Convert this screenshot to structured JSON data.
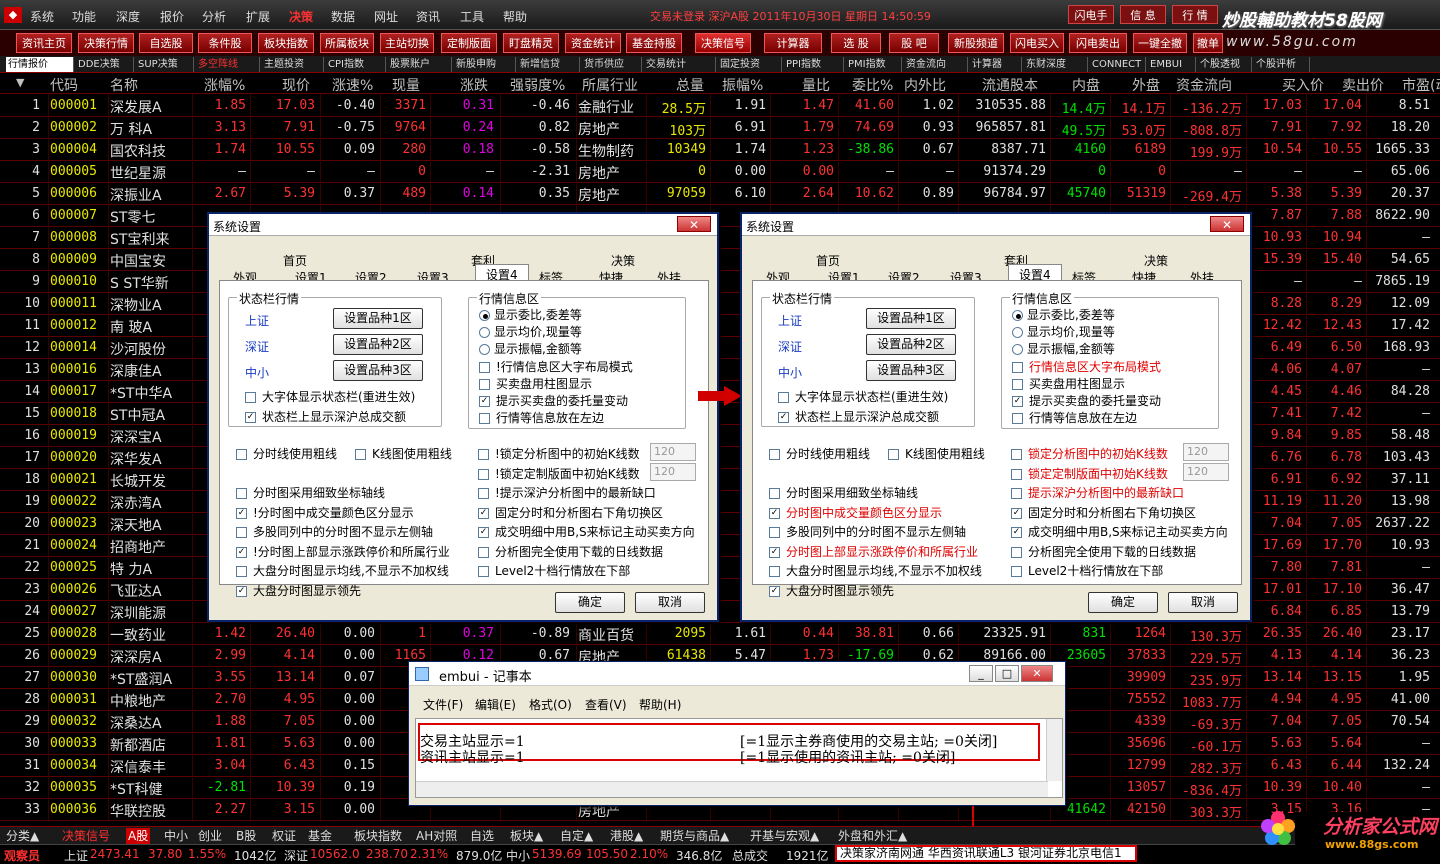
{
  "menu": {
    "items": [
      "系统",
      "功能",
      "深度",
      "报价",
      "分析",
      "扩展",
      "决策",
      "数据",
      "网址",
      "资讯",
      "工具",
      "帮助"
    ],
    "active_index": 6,
    "status_title": "交易未登录  深沪A股  2011年10月30日  星期日  14:50:59",
    "right_buttons": [
      "闪电手",
      "信 息",
      "行 情"
    ]
  },
  "watermark": {
    "line1": "炒股輔助教材58股网",
    "line2": "www.58gu.com"
  },
  "toolbar": {
    "buttons": [
      "资讯主页",
      "决策行情",
      "自选股",
      "条件股",
      "板块指数",
      "所属板块",
      "主站切换",
      "定制版面",
      "盯盘精灵",
      "资金统计",
      "基金持股",
      "决策信号",
      "计算器",
      "选 股",
      "股 吧",
      "新股频道",
      "闪电买入",
      "闪电卖出",
      "一键全撤",
      "撤单"
    ],
    "selected_index": 11
  },
  "tabs": {
    "items": [
      "行情报价",
      "DDE决策",
      "SUP决策",
      "多空阵线",
      "主题投资",
      "CPI指数",
      "股票账户",
      "新股申购",
      "新增信贷",
      "货币供应",
      "交易统计",
      "固定投资",
      "PPI指数",
      "PMI指数",
      "资金流向",
      "计算器",
      "东财深度",
      "CONNECT",
      "EMBUI",
      "个股透视",
      "个股评析"
    ],
    "selected_index": 0,
    "red_index": 3
  },
  "table": {
    "headers": [
      "代码",
      "名称",
      "涨幅%",
      "现价",
      "涨速%",
      "现量",
      "涨跌",
      "强弱度%",
      "所属行业",
      "总量",
      "振幅%",
      "量比",
      "委比%",
      "内外比",
      "流通股本",
      "内盘",
      "外盘",
      "资金流向",
      "买入价",
      "卖出价",
      "市盈(动)"
    ],
    "rows": [
      [
        "1",
        "000001",
        "深发展A",
        "1.85",
        "17.03",
        "-0.40",
        "3371",
        "0.31",
        "-0.46",
        "金融行业",
        "28.5万",
        "1.91",
        "1.47",
        "41.60",
        "1.02",
        "310535.88",
        "14.4万",
        "14.1万",
        "-136.2万",
        "17.03",
        "17.04",
        "8.51"
      ],
      [
        "2",
        "000002",
        "万 科A",
        "3.13",
        "7.91",
        "-0.75",
        "9764",
        "0.24",
        "0.82",
        "房地产",
        "103万",
        "6.91",
        "1.79",
        "74.69",
        "0.93",
        "965857.81",
        "49.5万",
        "53.0万",
        "-808.8万",
        "7.91",
        "7.92",
        "18.20"
      ],
      [
        "3",
        "000004",
        "国农科技",
        "1.74",
        "10.55",
        "0.09",
        "280",
        "0.18",
        "-0.58",
        "生物制药",
        "10349",
        "1.74",
        "1.23",
        "-38.86",
        "0.67",
        "8387.71",
        "4160",
        "6189",
        "199.9万",
        "10.54",
        "10.55",
        "1665.33"
      ],
      [
        "4",
        "000005",
        "世纪星源",
        "—",
        "—",
        "—",
        "0",
        "—",
        "-2.31",
        "房地产",
        "0",
        "0.00",
        "0.00",
        "—",
        "—",
        "91374.29",
        "0",
        "0",
        "—",
        "—",
        "—",
        "65.06"
      ],
      [
        "5",
        "000006",
        "深振业A",
        "2.67",
        "5.39",
        "0.37",
        "489",
        "0.14",
        "0.35",
        "房地产",
        "97059",
        "6.10",
        "2.64",
        "10.62",
        "0.89",
        "96784.97",
        "45740",
        "51319",
        "-269.4万",
        "5.38",
        "5.39",
        "20.37"
      ],
      [
        "6",
        "000007",
        "ST零七",
        "",
        "",
        "",
        "",
        "",
        "",
        "",
        "",
        "",
        "",
        "",
        "",
        "",
        "",
        "",
        "",
        "7.87",
        "7.88",
        "8622.90"
      ],
      [
        "7",
        "000008",
        "ST宝利来",
        "",
        "",
        "",
        "",
        "",
        "",
        "",
        "",
        "",
        "",
        "",
        "",
        "",
        "",
        "",
        "",
        "10.93",
        "10.94",
        "—"
      ],
      [
        "8",
        "000009",
        "中国宝安",
        "",
        "",
        "",
        "",
        "",
        "",
        "",
        "",
        "",
        "",
        "",
        "",
        "",
        "",
        "",
        "",
        "15.39",
        "15.40",
        "54.65"
      ],
      [
        "9",
        "000010",
        "S ST华新",
        "",
        "",
        "",
        "",
        "",
        "",
        "",
        "",
        "",
        "",
        "",
        "",
        "",
        "",
        "",
        "",
        "—",
        "—",
        "7865.19"
      ],
      [
        "10",
        "000011",
        "深物业A",
        "",
        "",
        "",
        "",
        "",
        "",
        "",
        "",
        "",
        "",
        "",
        "",
        "",
        "",
        "",
        "",
        "8.28",
        "8.29",
        "12.09"
      ],
      [
        "11",
        "000012",
        "南 玻A",
        "",
        "",
        "",
        "",
        "",
        "",
        "",
        "",
        "",
        "",
        "",
        "",
        "",
        "",
        "",
        "",
        "12.42",
        "12.43",
        "17.42"
      ],
      [
        "12",
        "000014",
        "沙河股份",
        "",
        "",
        "",
        "",
        "",
        "",
        "",
        "",
        "",
        "",
        "",
        "",
        "",
        "",
        "",
        "",
        "6.49",
        "6.50",
        "168.93"
      ],
      [
        "13",
        "000016",
        "深康佳A",
        "",
        "",
        "",
        "",
        "",
        "",
        "",
        "",
        "",
        "",
        "",
        "",
        "",
        "",
        "",
        "",
        "4.06",
        "4.07",
        "—"
      ],
      [
        "14",
        "000017",
        "*ST中华A",
        "",
        "",
        "",
        "",
        "",
        "",
        "",
        "",
        "",
        "",
        "",
        "",
        "",
        "",
        "",
        "",
        "4.45",
        "4.46",
        "84.28"
      ],
      [
        "15",
        "000018",
        "ST中冠A",
        "",
        "",
        "",
        "",
        "",
        "",
        "",
        "",
        "",
        "",
        "",
        "",
        "",
        "",
        "",
        "",
        "7.41",
        "7.42",
        "—"
      ],
      [
        "16",
        "000019",
        "深深宝A",
        "",
        "",
        "",
        "",
        "",
        "",
        "",
        "",
        "",
        "",
        "",
        "",
        "",
        "",
        "",
        "",
        "9.84",
        "9.85",
        "58.48"
      ],
      [
        "17",
        "000020",
        "深华发A",
        "",
        "",
        "",
        "",
        "",
        "",
        "",
        "",
        "",
        "",
        "",
        "",
        "",
        "",
        "",
        "",
        "6.76",
        "6.78",
        "103.43"
      ],
      [
        "18",
        "000021",
        "长城开发",
        "",
        "",
        "",
        "",
        "",
        "",
        "",
        "",
        "",
        "",
        "",
        "",
        "",
        "",
        "",
        "",
        "6.91",
        "6.92",
        "37.11"
      ],
      [
        "19",
        "000022",
        "深赤湾A",
        "",
        "",
        "",
        "",
        "",
        "",
        "",
        "",
        "",
        "",
        "",
        "",
        "",
        "",
        "",
        "",
        "11.19",
        "11.20",
        "13.98"
      ],
      [
        "20",
        "000023",
        "深天地A",
        "",
        "",
        "",
        "",
        "",
        "",
        "",
        "",
        "",
        "",
        "",
        "",
        "",
        "",
        "",
        "",
        "7.04",
        "7.05",
        "2637.22"
      ],
      [
        "21",
        "000024",
        "招商地产",
        "",
        "",
        "",
        "",
        "",
        "",
        "",
        "",
        "",
        "",
        "",
        "",
        "",
        "",
        "",
        "",
        "17.69",
        "17.70",
        "10.93"
      ],
      [
        "22",
        "000025",
        "特 力A",
        "",
        "",
        "",
        "",
        "",
        "",
        "",
        "",
        "",
        "",
        "",
        "",
        "",
        "",
        "",
        "",
        "7.80",
        "7.81",
        "—"
      ],
      [
        "23",
        "000026",
        "飞亚达A",
        "",
        "",
        "",
        "",
        "",
        "",
        "",
        "",
        "",
        "",
        "",
        "",
        "",
        "",
        "",
        "",
        "17.01",
        "17.10",
        "36.47"
      ],
      [
        "24",
        "000027",
        "深圳能源",
        "",
        "",
        "",
        "",
        "",
        "",
        "",
        "",
        "",
        "",
        "",
        "",
        "",
        "",
        "",
        "",
        "6.84",
        "6.85",
        "13.79"
      ],
      [
        "25",
        "000028",
        "一致药业",
        "1.42",
        "26.40",
        "0.00",
        "1",
        "0.37",
        "-0.89",
        "商业百货",
        "2095",
        "1.61",
        "0.44",
        "38.81",
        "0.66",
        "23325.91",
        "831",
        "1264",
        "130.3万",
        "26.35",
        "26.40",
        "23.17"
      ],
      [
        "26",
        "000029",
        "深深房A",
        "2.99",
        "4.14",
        "0.00",
        "1165",
        "0.12",
        "0.67",
        "房地产",
        "61438",
        "5.47",
        "1.73",
        "-17.69",
        "0.62",
        "89166.00",
        "23605",
        "37833",
        "229.5万",
        "4.13",
        "4.14",
        "36.23"
      ],
      [
        "27",
        "000030",
        "*ST盛润A",
        "3.55",
        "13.14",
        "0.07",
        "",
        "",
        "",
        "",
        "",
        "",
        "",
        "",
        "",
        "",
        "",
        "39909",
        "235.9万",
        "13.14",
        "13.15",
        "1.95"
      ],
      [
        "28",
        "000031",
        "中粮地产",
        "2.70",
        "4.95",
        "0.00",
        "",
        "",
        "",
        "",
        "",
        "",
        "",
        "",
        "",
        "",
        "",
        "75552",
        "1083.7万",
        "4.94",
        "4.95",
        "41.00"
      ],
      [
        "29",
        "000032",
        "深桑达A",
        "1.88",
        "7.05",
        "0.00",
        "",
        "",
        "",
        "",
        "",
        "",
        "",
        "",
        "",
        "",
        "",
        "4339",
        "-69.3万",
        "7.04",
        "7.05",
        "70.54"
      ],
      [
        "30",
        "000033",
        "新都酒店",
        "1.81",
        "5.63",
        "0.00",
        "",
        "",
        "",
        "",
        "",
        "",
        "",
        "",
        "",
        "",
        "",
        "35696",
        "-60.1万",
        "5.63",
        "5.64",
        "—"
      ],
      [
        "31",
        "000034",
        "深信泰丰",
        "3.04",
        "6.43",
        "0.15",
        "",
        "",
        "",
        "",
        "",
        "",
        "",
        "",
        "",
        "",
        "",
        "12799",
        "282.3万",
        "6.43",
        "6.44",
        "132.24"
      ],
      [
        "32",
        "000035",
        "*ST科健",
        "-2.81",
        "10.39",
        "0.19",
        "",
        "",
        "",
        "",
        "",
        "",
        "",
        "",
        "",
        "",
        "",
        "13057",
        "-836.4万",
        "10.39",
        "10.40",
        "—"
      ],
      [
        "33",
        "000036",
        "华联控股",
        "2.27",
        "3.15",
        "0.00",
        "",
        "",
        "",
        "房地产",
        "",
        "",
        "",
        "",
        "",
        "",
        "41642",
        "42150",
        "303.3万",
        "3.15",
        "3.16",
        "—"
      ]
    ]
  },
  "dialog_left": {
    "title": "系统设置",
    "close": "✕",
    "tabs_top": [
      "首页",
      "套利",
      "决策"
    ],
    "tabs_bottom": [
      "外观",
      "设置1",
      "设置2",
      "设置3",
      "设置4",
      "标签",
      "快捷",
      "外挂"
    ],
    "selected_tab": "设置4",
    "group_status": "状态栏行情",
    "markets": [
      "上证",
      "深证",
      "中小"
    ],
    "market_buttons": [
      "设置品种1区",
      "设置品种2区",
      "设置品种3区"
    ],
    "status_checks": [
      "大字体显示状态栏(重进生效)",
      "状态栏上显示深沪总成交额"
    ],
    "group_quote": "行情信息区",
    "radios": [
      "显示委比,委差等",
      "显示均价,现量等",
      "显示振幅,金额等"
    ],
    "quote_checks": [
      "!行情信息区大字布局模式",
      "买卖盘用柱图显示",
      "提示买卖盘的委托量变动",
      "行情等信息放在左边"
    ],
    "left_checks": [
      "分时线使用粗线",
      "K线图使用粗线",
      "分时图采用细致坐标轴线",
      "!分时图中成交量颜色区分显示",
      "多股同列中的分时图不显示左侧轴",
      "!分时图上部显示涨跌停价和所属行业",
      "大盘分时图显示均线,不显示不加权线",
      "大盘分时图显示领先"
    ],
    "right_checks": [
      "!锁定分析图中的初始K线数",
      "!锁定定制版面中初始K线数",
      "!提示深沪分析图中的最新缺口",
      "固定分时和分析图右下角切换区",
      "成交明细中用B,S来标记主动买卖方向",
      "分析图完全使用下载的日线数据",
      "Level2十档行情放在下部"
    ],
    "num1": "120",
    "num2": "120",
    "ok": "确定",
    "cancel": "取消"
  },
  "dialog_right": {
    "title": "系统设置",
    "close": "✕",
    "tabs_top": [
      "首页",
      "套利",
      "决策"
    ],
    "tabs_bottom": [
      "外观",
      "设置1",
      "设置2",
      "设置3",
      "设置4",
      "标签",
      "快捷",
      "外挂"
    ],
    "group_status": "状态栏行情",
    "markets": [
      "上证",
      "深证",
      "中小"
    ],
    "market_buttons": [
      "设置品种1区",
      "设置品种2区",
      "设置品种3区"
    ],
    "status_checks": [
      "大字体显示状态栏(重进生效)",
      "状态栏上显示深沪总成交额"
    ],
    "group_quote": "行情信息区",
    "radios": [
      "显示委比,委差等",
      "显示均价,现量等",
      "显示振幅,金额等"
    ],
    "quote_checks": [
      "行情信息区大字布局模式",
      "买卖盘用柱图显示",
      "提示买卖盘的委托量变动",
      "行情等信息放在左边"
    ],
    "left_checks": [
      "分时线使用粗线",
      "K线图使用粗线",
      "分时图采用细致坐标轴线",
      "分时图中成交量颜色区分显示",
      "多股同列中的分时图不显示左侧轴",
      "分时图上部显示涨跌停价和所属行业",
      "大盘分时图显示均线,不显示不加权线",
      "大盘分时图显示领先"
    ],
    "right_checks": [
      "锁定分析图中的初始K线数",
      "锁定定制版面中初始K线数",
      "提示深沪分析图中的最新缺口",
      "固定分时和分析图右下角切换区",
      "成交明细中用B,S来标记主动买卖方向",
      "分析图完全使用下载的日线数据",
      "Level2十档行情放在下部"
    ],
    "num1": "120",
    "num2": "120",
    "ok": "确定",
    "cancel": "取消"
  },
  "notepad": {
    "title": "embui - 记事本",
    "menu": [
      "文件(F)",
      "编辑(E)",
      "格式(O)",
      "查看(V)",
      "帮助(H)"
    ],
    "line1_left": "交易主站显示=1",
    "line1_right": "[=1显示主券商使用的交易主站; =0关闭]",
    "line2_left": "资讯主站显示=1",
    "line2_right": "[=1显示使用的资讯主站; =0关闭]",
    "buttons": [
      "_",
      "□",
      "✕"
    ]
  },
  "bottom_tabs": [
    "分类▲",
    "决策信号",
    "A股",
    "中小",
    "创业",
    "B股",
    "权证",
    "基金",
    "板块指数",
    "AH对照",
    "自选",
    "板块▲",
    "自定▲",
    "港股▲",
    "期货与商品▲",
    "开基与宏观▲",
    "外盘和外汇▲"
  ],
  "statusbar": {
    "label": "观察员",
    "sh_label": "上证",
    "sh_value": "2473.41",
    "sh_change": "37.80",
    "sh_pct": "1.55%",
    "sh_amount": "1042亿",
    "sz_label": "深证",
    "sz_value": "10562.0",
    "sz_change": "238.70",
    "sz_pct": "2.31%",
    "sz_amount": "879.0亿",
    "zx_label": "中小",
    "zx_value": "5139.69",
    "zx_change": "105.50",
    "zx_pct": "2.10%",
    "zx_amount": "346.8亿",
    "total_label": "总成交",
    "total_value": "1921亿",
    "info": "决策家济南网通  华西资讯联通L3  银河证券北京电信1"
  },
  "corner_logo": {
    "line1": "分析家公式网",
    "line2": "www.88gs.com"
  }
}
